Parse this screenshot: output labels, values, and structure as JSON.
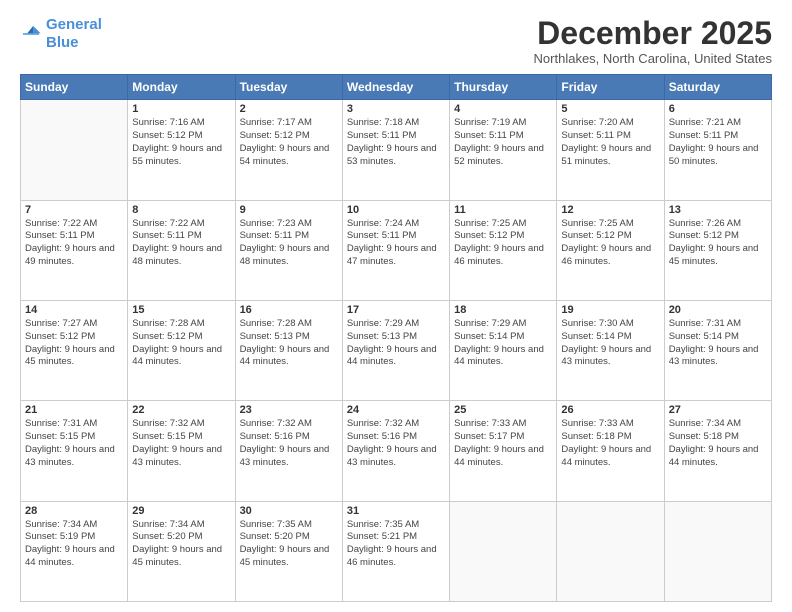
{
  "logo": {
    "line1": "General",
    "line2": "Blue"
  },
  "header": {
    "month": "December 2025",
    "location": "Northlakes, North Carolina, United States"
  },
  "days_of_week": [
    "Sunday",
    "Monday",
    "Tuesday",
    "Wednesday",
    "Thursday",
    "Friday",
    "Saturday"
  ],
  "weeks": [
    [
      {
        "day": "",
        "sunrise": "",
        "sunset": "",
        "daylight": "",
        "empty": true
      },
      {
        "day": "1",
        "sunrise": "Sunrise: 7:16 AM",
        "sunset": "Sunset: 5:12 PM",
        "daylight": "Daylight: 9 hours and 55 minutes."
      },
      {
        "day": "2",
        "sunrise": "Sunrise: 7:17 AM",
        "sunset": "Sunset: 5:12 PM",
        "daylight": "Daylight: 9 hours and 54 minutes."
      },
      {
        "day": "3",
        "sunrise": "Sunrise: 7:18 AM",
        "sunset": "Sunset: 5:11 PM",
        "daylight": "Daylight: 9 hours and 53 minutes."
      },
      {
        "day": "4",
        "sunrise": "Sunrise: 7:19 AM",
        "sunset": "Sunset: 5:11 PM",
        "daylight": "Daylight: 9 hours and 52 minutes."
      },
      {
        "day": "5",
        "sunrise": "Sunrise: 7:20 AM",
        "sunset": "Sunset: 5:11 PM",
        "daylight": "Daylight: 9 hours and 51 minutes."
      },
      {
        "day": "6",
        "sunrise": "Sunrise: 7:21 AM",
        "sunset": "Sunset: 5:11 PM",
        "daylight": "Daylight: 9 hours and 50 minutes."
      }
    ],
    [
      {
        "day": "7",
        "sunrise": "Sunrise: 7:22 AM",
        "sunset": "Sunset: 5:11 PM",
        "daylight": "Daylight: 9 hours and 49 minutes."
      },
      {
        "day": "8",
        "sunrise": "Sunrise: 7:22 AM",
        "sunset": "Sunset: 5:11 PM",
        "daylight": "Daylight: 9 hours and 48 minutes."
      },
      {
        "day": "9",
        "sunrise": "Sunrise: 7:23 AM",
        "sunset": "Sunset: 5:11 PM",
        "daylight": "Daylight: 9 hours and 48 minutes."
      },
      {
        "day": "10",
        "sunrise": "Sunrise: 7:24 AM",
        "sunset": "Sunset: 5:11 PM",
        "daylight": "Daylight: 9 hours and 47 minutes."
      },
      {
        "day": "11",
        "sunrise": "Sunrise: 7:25 AM",
        "sunset": "Sunset: 5:12 PM",
        "daylight": "Daylight: 9 hours and 46 minutes."
      },
      {
        "day": "12",
        "sunrise": "Sunrise: 7:25 AM",
        "sunset": "Sunset: 5:12 PM",
        "daylight": "Daylight: 9 hours and 46 minutes."
      },
      {
        "day": "13",
        "sunrise": "Sunrise: 7:26 AM",
        "sunset": "Sunset: 5:12 PM",
        "daylight": "Daylight: 9 hours and 45 minutes."
      }
    ],
    [
      {
        "day": "14",
        "sunrise": "Sunrise: 7:27 AM",
        "sunset": "Sunset: 5:12 PM",
        "daylight": "Daylight: 9 hours and 45 minutes."
      },
      {
        "day": "15",
        "sunrise": "Sunrise: 7:28 AM",
        "sunset": "Sunset: 5:12 PM",
        "daylight": "Daylight: 9 hours and 44 minutes."
      },
      {
        "day": "16",
        "sunrise": "Sunrise: 7:28 AM",
        "sunset": "Sunset: 5:13 PM",
        "daylight": "Daylight: 9 hours and 44 minutes."
      },
      {
        "day": "17",
        "sunrise": "Sunrise: 7:29 AM",
        "sunset": "Sunset: 5:13 PM",
        "daylight": "Daylight: 9 hours and 44 minutes."
      },
      {
        "day": "18",
        "sunrise": "Sunrise: 7:29 AM",
        "sunset": "Sunset: 5:14 PM",
        "daylight": "Daylight: 9 hours and 44 minutes."
      },
      {
        "day": "19",
        "sunrise": "Sunrise: 7:30 AM",
        "sunset": "Sunset: 5:14 PM",
        "daylight": "Daylight: 9 hours and 43 minutes."
      },
      {
        "day": "20",
        "sunrise": "Sunrise: 7:31 AM",
        "sunset": "Sunset: 5:14 PM",
        "daylight": "Daylight: 9 hours and 43 minutes."
      }
    ],
    [
      {
        "day": "21",
        "sunrise": "Sunrise: 7:31 AM",
        "sunset": "Sunset: 5:15 PM",
        "daylight": "Daylight: 9 hours and 43 minutes."
      },
      {
        "day": "22",
        "sunrise": "Sunrise: 7:32 AM",
        "sunset": "Sunset: 5:15 PM",
        "daylight": "Daylight: 9 hours and 43 minutes."
      },
      {
        "day": "23",
        "sunrise": "Sunrise: 7:32 AM",
        "sunset": "Sunset: 5:16 PM",
        "daylight": "Daylight: 9 hours and 43 minutes."
      },
      {
        "day": "24",
        "sunrise": "Sunrise: 7:32 AM",
        "sunset": "Sunset: 5:16 PM",
        "daylight": "Daylight: 9 hours and 43 minutes."
      },
      {
        "day": "25",
        "sunrise": "Sunrise: 7:33 AM",
        "sunset": "Sunset: 5:17 PM",
        "daylight": "Daylight: 9 hours and 44 minutes."
      },
      {
        "day": "26",
        "sunrise": "Sunrise: 7:33 AM",
        "sunset": "Sunset: 5:18 PM",
        "daylight": "Daylight: 9 hours and 44 minutes."
      },
      {
        "day": "27",
        "sunrise": "Sunrise: 7:34 AM",
        "sunset": "Sunset: 5:18 PM",
        "daylight": "Daylight: 9 hours and 44 minutes."
      }
    ],
    [
      {
        "day": "28",
        "sunrise": "Sunrise: 7:34 AM",
        "sunset": "Sunset: 5:19 PM",
        "daylight": "Daylight: 9 hours and 44 minutes."
      },
      {
        "day": "29",
        "sunrise": "Sunrise: 7:34 AM",
        "sunset": "Sunset: 5:20 PM",
        "daylight": "Daylight: 9 hours and 45 minutes."
      },
      {
        "day": "30",
        "sunrise": "Sunrise: 7:35 AM",
        "sunset": "Sunset: 5:20 PM",
        "daylight": "Daylight: 9 hours and 45 minutes."
      },
      {
        "day": "31",
        "sunrise": "Sunrise: 7:35 AM",
        "sunset": "Sunset: 5:21 PM",
        "daylight": "Daylight: 9 hours and 46 minutes."
      },
      {
        "day": "",
        "sunrise": "",
        "sunset": "",
        "daylight": "",
        "empty": true
      },
      {
        "day": "",
        "sunrise": "",
        "sunset": "",
        "daylight": "",
        "empty": true
      },
      {
        "day": "",
        "sunrise": "",
        "sunset": "",
        "daylight": "",
        "empty": true
      }
    ]
  ]
}
